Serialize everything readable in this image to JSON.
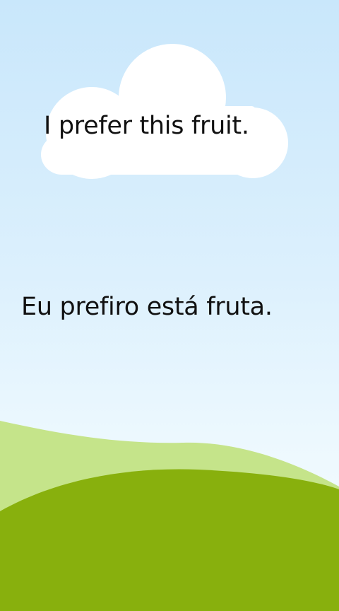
{
  "lesson": {
    "english_sentence": "I prefer this fruit.",
    "portuguese_sentence": "Eu prefiro está fruta."
  },
  "colors": {
    "sky_top": "#c9e7fb",
    "sky_bottom": "#f4fcff",
    "cloud": "#ffffff",
    "hill_light": "#c5e48a",
    "hill_dark": "#88b00d",
    "text": "#111111"
  },
  "icons": {
    "cloud": "cloud-icon",
    "hills": "grass-hills-icon"
  }
}
